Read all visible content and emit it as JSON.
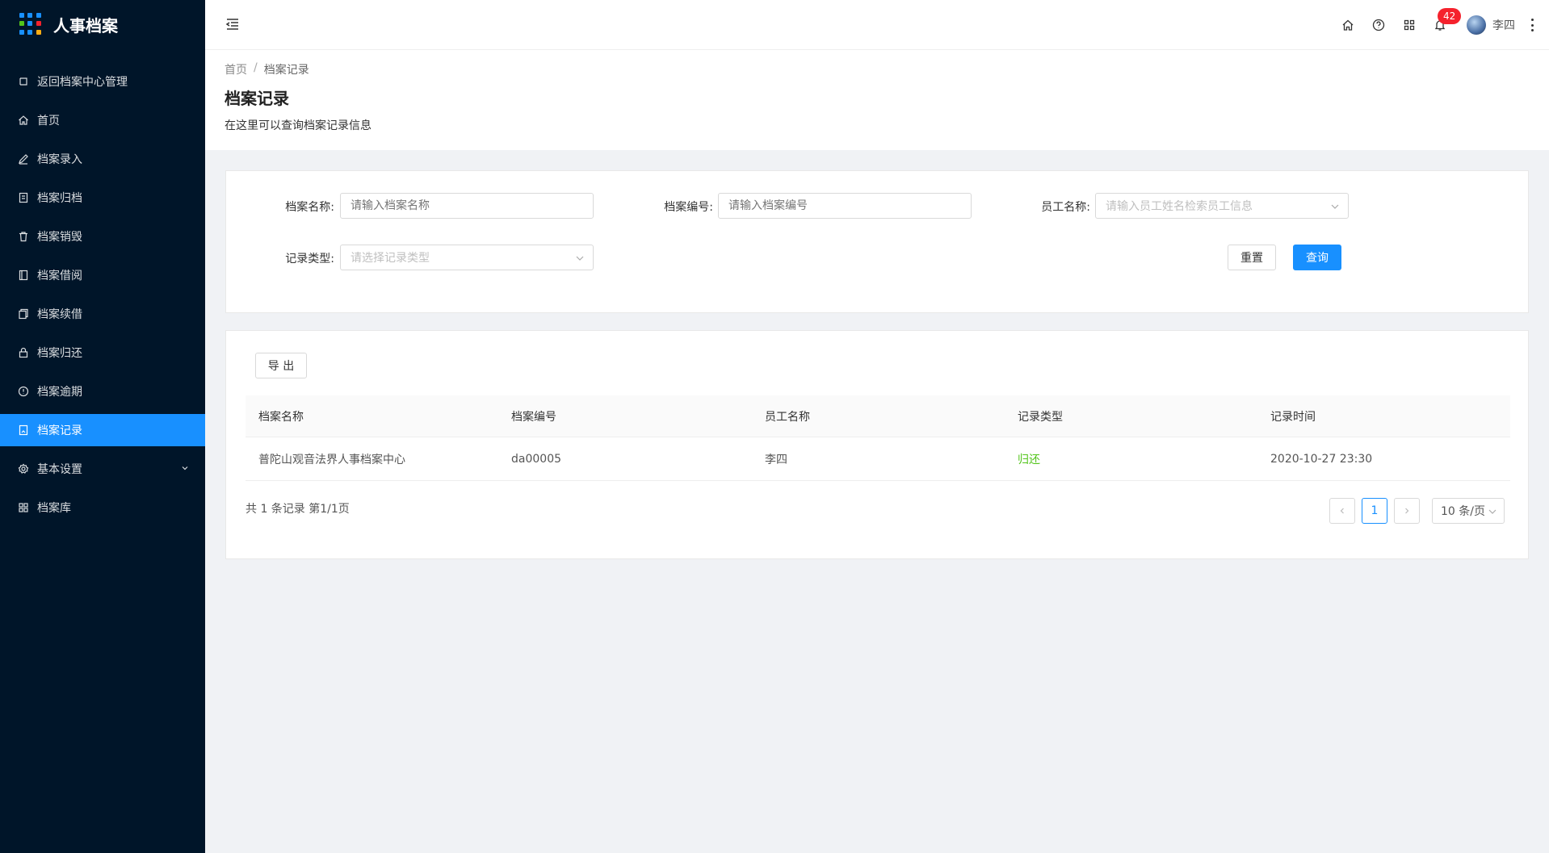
{
  "app": {
    "title": "人事档案",
    "logo_colors": [
      "#1890ff",
      "#1890ff",
      "#1890ff",
      "#52c41a",
      "#1890ff",
      "#f5222d",
      "#1890ff",
      "#1890ff",
      "#faad14"
    ]
  },
  "sidebar": {
    "items": [
      {
        "label": "返回档案中心管理",
        "icon": "return-icon"
      },
      {
        "label": "首页",
        "icon": "home-icon"
      },
      {
        "label": "档案录入",
        "icon": "edit-icon"
      },
      {
        "label": "档案归档",
        "icon": "archive-icon"
      },
      {
        "label": "档案销毁",
        "icon": "trash-icon"
      },
      {
        "label": "档案借阅",
        "icon": "book-icon"
      },
      {
        "label": "档案续借",
        "icon": "copy-icon"
      },
      {
        "label": "档案归还",
        "icon": "lock-icon"
      },
      {
        "label": "档案逾期",
        "icon": "warning-icon"
      },
      {
        "label": "档案记录",
        "icon": "record-icon",
        "active": true
      },
      {
        "label": "基本设置",
        "icon": "gear-icon"
      },
      {
        "label": "档案库",
        "icon": "grid-icon"
      }
    ]
  },
  "header": {
    "notification_count": "42",
    "username": "李四"
  },
  "breadcrumb": {
    "home": "首页",
    "separator": "/",
    "current": "档案记录"
  },
  "page": {
    "title": "档案记录",
    "description": "在这里可以查询档案记录信息"
  },
  "filters": {
    "archive_name_label": "档案名称:",
    "archive_name_placeholder": "请输入档案名称",
    "archive_no_label": "档案编号:",
    "archive_no_placeholder": "请输入档案编号",
    "employee_label": "员工名称:",
    "employee_placeholder": "请输入员工姓名检索员工信息",
    "record_type_label": "记录类型:",
    "record_type_placeholder": "请选择记录类型",
    "reset_label": "重置",
    "search_label": "查询"
  },
  "table": {
    "export_label": "导 出",
    "columns": [
      "档案名称",
      "档案编号",
      "员工名称",
      "记录类型",
      "记录时间"
    ],
    "rows": [
      [
        "普陀山观音法界人事档案中心",
        "da00005",
        "李四",
        "归还",
        "2020-10-27 23:30"
      ]
    ]
  },
  "pagination": {
    "total_text": "共 1 条记录 第1/1页",
    "current_page": "1",
    "page_size": "10 条/页"
  },
  "colors": {
    "sidebar_bg": "#001529",
    "primary": "#1890ff",
    "success": "#52c41a",
    "badge": "#f5222d"
  }
}
